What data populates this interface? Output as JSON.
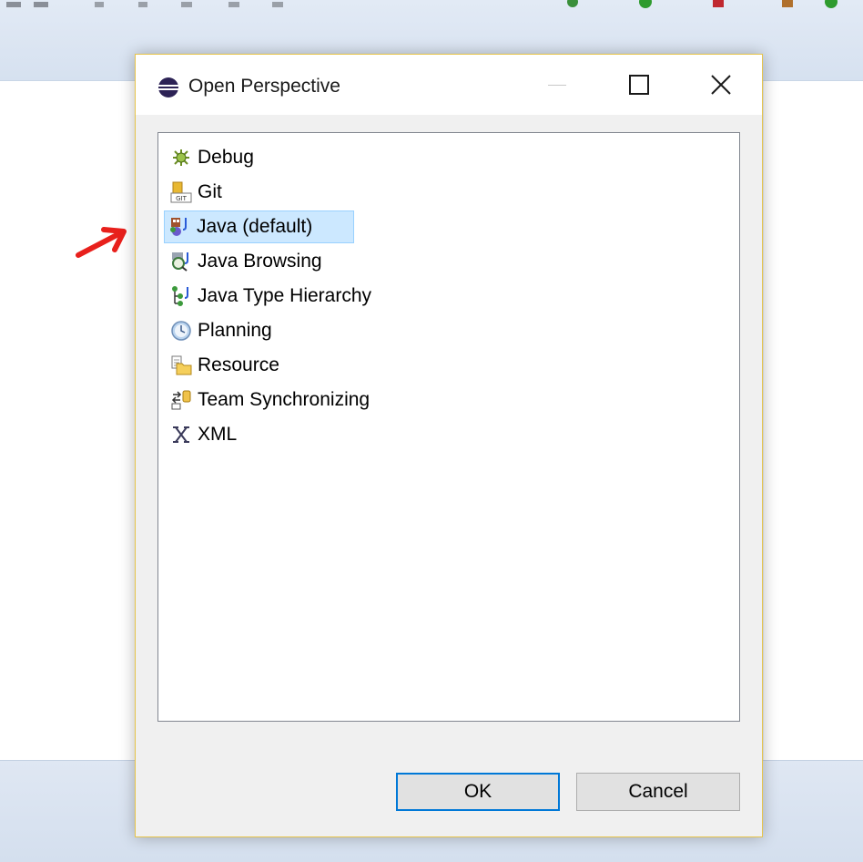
{
  "dialog": {
    "title": "Open Perspective",
    "perspectives": [
      {
        "label": "Debug",
        "icon": "debug-icon",
        "selected": false
      },
      {
        "label": "Git",
        "icon": "git-icon",
        "selected": false
      },
      {
        "label": "Java (default)",
        "icon": "java-perspective-icon",
        "selected": true
      },
      {
        "label": "Java Browsing",
        "icon": "java-browsing-icon",
        "selected": false
      },
      {
        "label": "Java Type Hierarchy",
        "icon": "type-hierarchy-icon",
        "selected": false
      },
      {
        "label": "Planning",
        "icon": "planning-clock-icon",
        "selected": false
      },
      {
        "label": "Resource",
        "icon": "resource-folder-icon",
        "selected": false
      },
      {
        "label": "Team Synchronizing",
        "icon": "team-sync-icon",
        "selected": false
      },
      {
        "label": "XML",
        "icon": "xml-icon",
        "selected": false
      }
    ],
    "ok_label": "OK",
    "cancel_label": "Cancel"
  },
  "colors": {
    "selection_bg": "#cce8ff",
    "selection_border": "#99d1ff",
    "default_button_border": "#0078d7",
    "dialog_border": "#e6c44a",
    "annotation_arrow": "#e8201c"
  }
}
